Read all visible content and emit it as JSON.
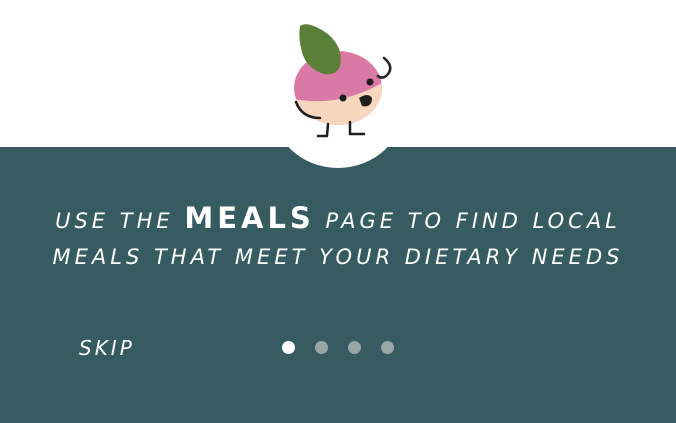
{
  "onboarding": {
    "message": {
      "line1_before": "USE THE",
      "line1_emphasis": "MEALS",
      "line1_after": "PAGE TO FIND LOCAL",
      "line2": "MEALS THAT MEET YOUR DIETARY NEEDS"
    },
    "skip_label": "SKIP",
    "pagination": {
      "total_pages": 4,
      "current_page": 1
    },
    "mascot_icon": "turnip-mascot-icon"
  },
  "colors": {
    "panel_background": "#365c61",
    "top_background": "#ffffff",
    "text": "#ffffff",
    "dot_active": "#ffffff",
    "dot_inactive": "#9aa5a6",
    "mascot_body": "#d97aa6",
    "mascot_bottom": "#f6d7bd",
    "mascot_leaf": "#5a7f37"
  }
}
